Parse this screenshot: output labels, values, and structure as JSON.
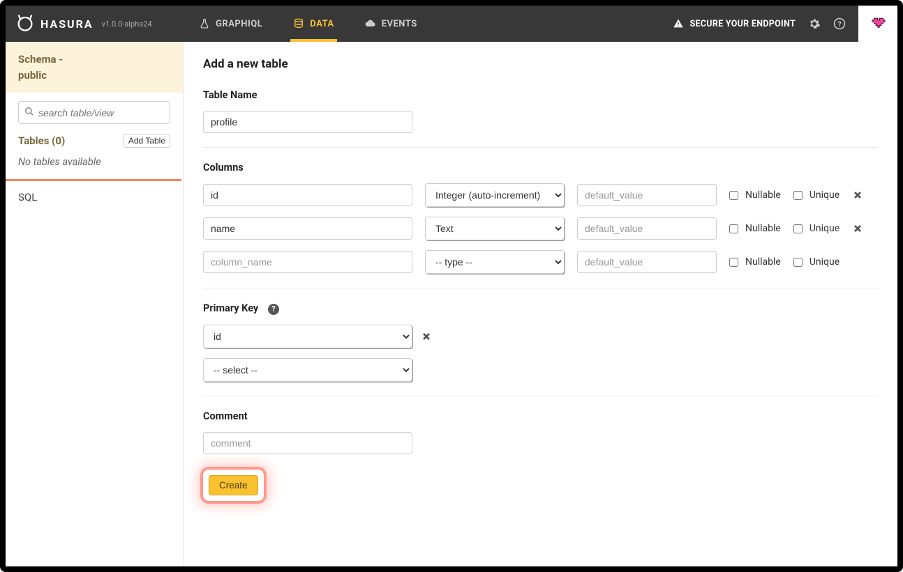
{
  "app": {
    "name": "HASURA",
    "version": "v1.0.0-alpha24"
  },
  "nav": {
    "graphiql": "GRAPHIQL",
    "data": "DATA",
    "events": "EVENTS"
  },
  "topbar": {
    "secure": "SECURE YOUR ENDPOINT"
  },
  "sidebar": {
    "schema_label_line1": "Schema -",
    "schema_label_line2": "public",
    "search_placeholder": "search table/view",
    "tables_label": "Tables (0)",
    "add_table": "Add Table",
    "no_tables": "No tables available",
    "sql": "SQL"
  },
  "main": {
    "title": "Add a new table",
    "table_name_label": "Table Name",
    "table_name_value": "profile",
    "columns_label": "Columns",
    "nullable_label": "Nullable",
    "unique_label": "Unique",
    "default_placeholder": "default_value",
    "column_name_placeholder": "column_name",
    "type_placeholder": "-- type --",
    "columns": [
      {
        "name": "id",
        "type": "Integer (auto-increment)",
        "removable": true
      },
      {
        "name": "name",
        "type": "Text",
        "removable": true
      },
      {
        "name": "",
        "type": "-- type --",
        "removable": false
      }
    ],
    "primary_key_label": "Primary Key",
    "pk_select_placeholder": "-- select --",
    "pk_values": [
      "id"
    ],
    "comment_label": "Comment",
    "comment_placeholder": "comment",
    "create": "Create"
  }
}
